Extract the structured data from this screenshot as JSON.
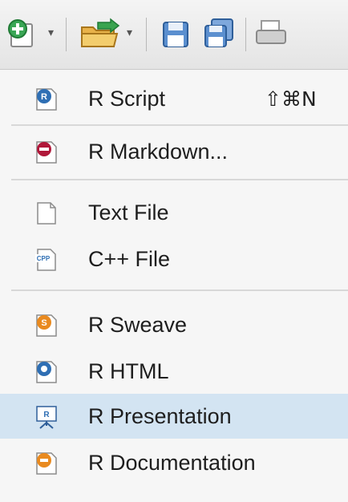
{
  "toolbar": {
    "items": [
      {
        "name": "new-file-icon",
        "has_dropdown": true
      },
      {
        "name": "open-project-icon",
        "has_dropdown": true
      },
      {
        "name": "save-icon",
        "has_dropdown": false
      },
      {
        "name": "save-all-icon",
        "has_dropdown": false
      },
      {
        "name": "print-icon",
        "has_dropdown": false
      }
    ]
  },
  "menu": {
    "items": [
      {
        "label": "R Script",
        "shortcut": "⇧⌘N",
        "icon": "r-script-icon"
      },
      {
        "label": "R Markdown...",
        "shortcut": "",
        "icon": "r-markdown-icon"
      },
      {
        "label": "Text File",
        "shortcut": "",
        "icon": "text-file-icon"
      },
      {
        "label": "C++ File",
        "shortcut": "",
        "icon": "cpp-file-icon"
      },
      {
        "label": "R Sweave",
        "shortcut": "",
        "icon": "r-sweave-icon"
      },
      {
        "label": "R HTML",
        "shortcut": "",
        "icon": "r-html-icon"
      },
      {
        "label": "R Presentation",
        "shortcut": "",
        "icon": "r-presentation-icon",
        "highlighted": true
      },
      {
        "label": "R Documentation",
        "shortcut": "",
        "icon": "r-documentation-icon"
      }
    ]
  },
  "colors": {
    "highlight": "#d3e4f2",
    "menu_bg": "#f6f6f6",
    "r_blue": "#2f6fb4",
    "r_red": "#b0183a",
    "r_orange": "#e98a1f",
    "toolbar_green": "#2e9f4a"
  }
}
